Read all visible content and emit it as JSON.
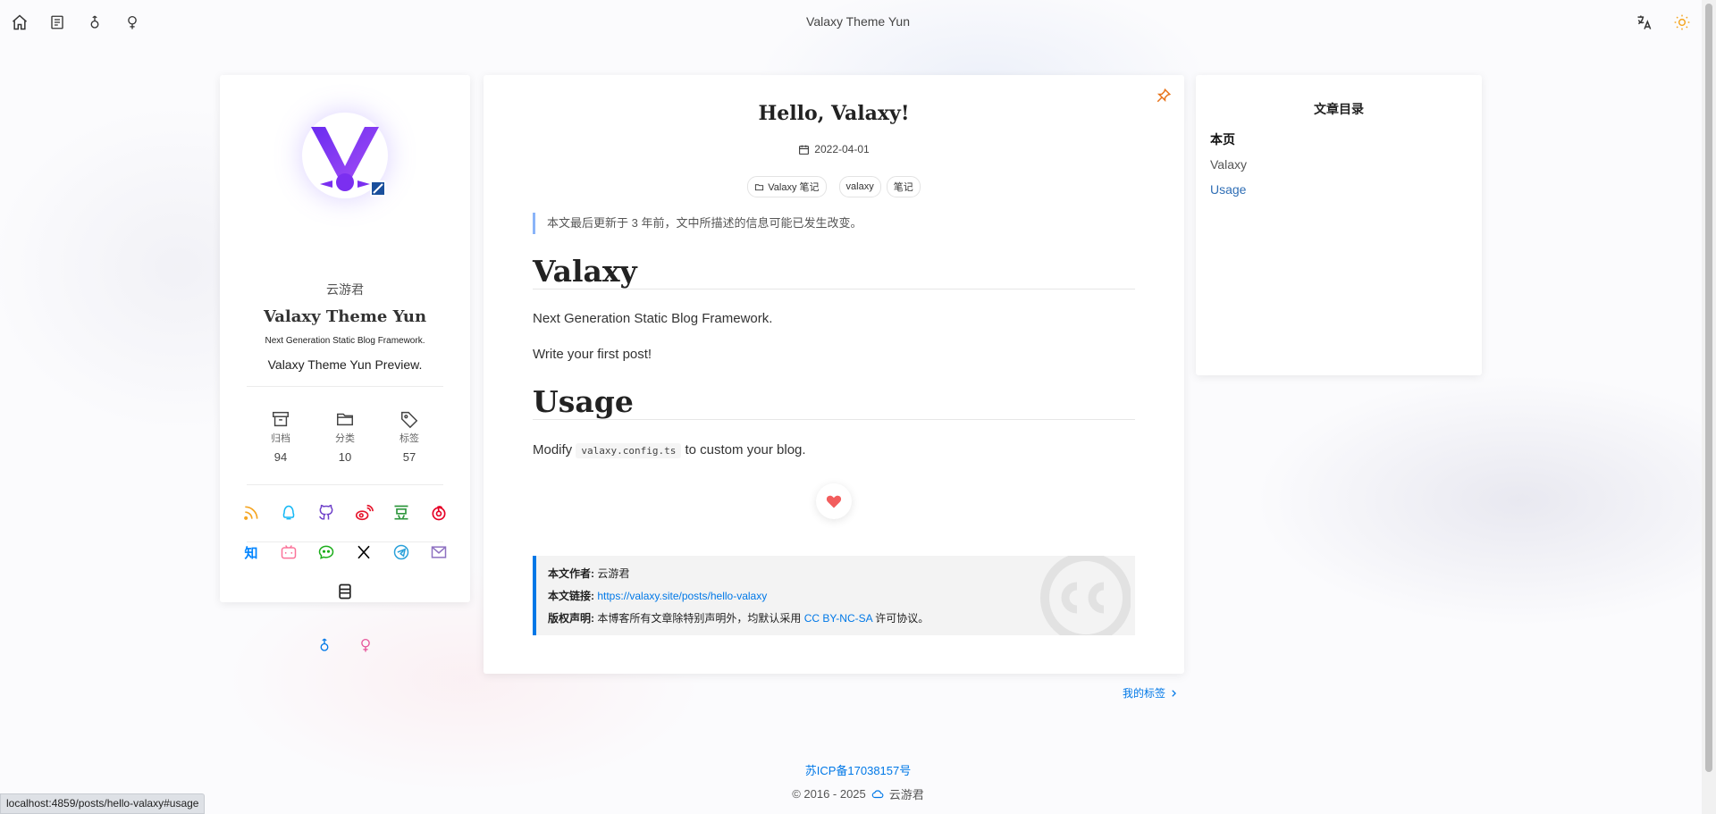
{
  "header": {
    "site_title": "Valaxy Theme Yun",
    "left_icons": [
      "home-icon",
      "document-icon",
      "male-icon",
      "female-icon"
    ],
    "right_icons": [
      "translate-icon",
      "sun-icon"
    ],
    "accent_sun": "#f5a623"
  },
  "profile": {
    "name": "云游君",
    "title": "Valaxy Theme Yun",
    "subtitle": "Next Generation Static Blog Framework.",
    "description": "Valaxy Theme Yun Preview.",
    "stats": [
      {
        "label": "归档",
        "value": "94",
        "icon": "archive-icon"
      },
      {
        "label": "分类",
        "value": "10",
        "icon": "folder-icon"
      },
      {
        "label": "标签",
        "value": "57",
        "icon": "tag-icon"
      }
    ],
    "social_text": {
      "zhihu": "知"
    },
    "social_icons": [
      "rss-icon",
      "qq-icon",
      "github-icon",
      "weibo-icon",
      "douban-icon",
      "netease-music-icon",
      "zhihu-icon",
      "bilibili-icon",
      "wechat-icon",
      "x-icon",
      "telegram-icon",
      "email-icon",
      "travelling-icon"
    ],
    "bottom_icons": [
      "male-icon",
      "female-icon"
    ]
  },
  "article": {
    "title": "Hello, Valaxy!",
    "date": "2022-04-01",
    "category": "Valaxy 笔记",
    "tags": [
      "valaxy",
      "笔记"
    ],
    "outdated_notice": "本文最后更新于 3 年前，文中所描述的信息可能已发生改变。",
    "h1_valaxy": "Valaxy",
    "p1": "Next Generation Static Blog Framework.",
    "p2": "Write your first post!",
    "h1_usage": "Usage",
    "p3_before": "Modify",
    "p3_code": "valaxy.config.ts",
    "p3_after": "to custom your blog.",
    "copyright": {
      "author_label": "本文作者:",
      "author": "云游君",
      "link_label": "本文链接:",
      "link": "https://valaxy.site/posts/hello-valaxy",
      "license_label": "版权声明:",
      "license_before": "本博客所有文章除特别声明外，均默认采用",
      "license_name": "CC BY-NC-SA",
      "license_after": "许可协议。"
    },
    "next_link": "我的标签"
  },
  "toc": {
    "title": "文章目录",
    "items": [
      {
        "label": "本页"
      },
      {
        "label": "Valaxy"
      },
      {
        "label": "Usage"
      }
    ]
  },
  "footer": {
    "icp": "苏ICP备17038157号",
    "copyright_years": "© 2016 - 2025",
    "author": "云游君"
  },
  "status_bar": {
    "url": "localhost:4859/posts/hello-valaxy#usage"
  },
  "colors": {
    "link": "#0078e7",
    "toc_active": "#2f6eb5",
    "pin": "#e8731a",
    "heart": "#f25d5d"
  }
}
